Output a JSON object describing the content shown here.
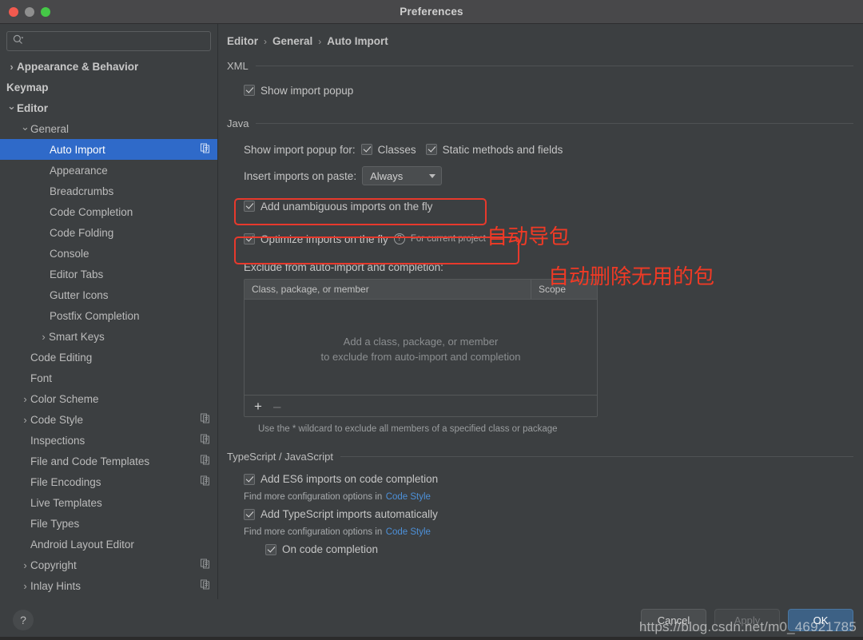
{
  "window": {
    "title": "Preferences",
    "traffic_lights": [
      "close",
      "minimize",
      "zoom"
    ]
  },
  "sidebar": {
    "search": {
      "value": "",
      "placeholder": ""
    },
    "items": [
      {
        "label": "Appearance & Behavior",
        "level": 0,
        "arrow": "collapsed",
        "bold": true,
        "selected": false,
        "copy_icon": false
      },
      {
        "label": "Keymap",
        "level": 0,
        "arrow": "none",
        "bold": true,
        "selected": false,
        "copy_icon": false
      },
      {
        "label": "Editor",
        "level": 0,
        "arrow": "expanded",
        "bold": true,
        "selected": false,
        "copy_icon": false
      },
      {
        "label": "General",
        "level": 1,
        "arrow": "expanded",
        "bold": false,
        "selected": false,
        "copy_icon": false
      },
      {
        "label": "Auto Import",
        "level": 2,
        "arrow": "none",
        "bold": false,
        "selected": true,
        "copy_icon": true
      },
      {
        "label": "Appearance",
        "level": 2,
        "arrow": "none",
        "bold": false,
        "selected": false,
        "copy_icon": false
      },
      {
        "label": "Breadcrumbs",
        "level": 2,
        "arrow": "none",
        "bold": false,
        "selected": false,
        "copy_icon": false
      },
      {
        "label": "Code Completion",
        "level": 2,
        "arrow": "none",
        "bold": false,
        "selected": false,
        "copy_icon": false
      },
      {
        "label": "Code Folding",
        "level": 2,
        "arrow": "none",
        "bold": false,
        "selected": false,
        "copy_icon": false
      },
      {
        "label": "Console",
        "level": 2,
        "arrow": "none",
        "bold": false,
        "selected": false,
        "copy_icon": false
      },
      {
        "label": "Editor Tabs",
        "level": 2,
        "arrow": "none",
        "bold": false,
        "selected": false,
        "copy_icon": false
      },
      {
        "label": "Gutter Icons",
        "level": 2,
        "arrow": "none",
        "bold": false,
        "selected": false,
        "copy_icon": false
      },
      {
        "label": "Postfix Completion",
        "level": 2,
        "arrow": "none",
        "bold": false,
        "selected": false,
        "copy_icon": false
      },
      {
        "label": "Smart Keys",
        "level": 2,
        "arrow": "collapsed",
        "bold": false,
        "selected": false,
        "copy_icon": false
      },
      {
        "label": "Code Editing",
        "level": 1,
        "arrow": "none",
        "bold": false,
        "selected": false,
        "copy_icon": false
      },
      {
        "label": "Font",
        "level": 1,
        "arrow": "none",
        "bold": false,
        "selected": false,
        "copy_icon": false
      },
      {
        "label": "Color Scheme",
        "level": 1,
        "arrow": "collapsed",
        "bold": false,
        "selected": false,
        "copy_icon": false
      },
      {
        "label": "Code Style",
        "level": 1,
        "arrow": "collapsed",
        "bold": false,
        "selected": false,
        "copy_icon": true
      },
      {
        "label": "Inspections",
        "level": 1,
        "arrow": "none",
        "bold": false,
        "selected": false,
        "copy_icon": true
      },
      {
        "label": "File and Code Templates",
        "level": 1,
        "arrow": "none",
        "bold": false,
        "selected": false,
        "copy_icon": true
      },
      {
        "label": "File Encodings",
        "level": 1,
        "arrow": "none",
        "bold": false,
        "selected": false,
        "copy_icon": true
      },
      {
        "label": "Live Templates",
        "level": 1,
        "arrow": "none",
        "bold": false,
        "selected": false,
        "copy_icon": false
      },
      {
        "label": "File Types",
        "level": 1,
        "arrow": "none",
        "bold": false,
        "selected": false,
        "copy_icon": false
      },
      {
        "label": "Android Layout Editor",
        "level": 1,
        "arrow": "none",
        "bold": false,
        "selected": false,
        "copy_icon": false
      },
      {
        "label": "Copyright",
        "level": 1,
        "arrow": "collapsed",
        "bold": false,
        "selected": false,
        "copy_icon": true
      },
      {
        "label": "Inlay Hints",
        "level": 1,
        "arrow": "collapsed",
        "bold": false,
        "selected": false,
        "copy_icon": true
      }
    ]
  },
  "breadcrumb": {
    "parts": [
      "Editor",
      "General",
      "Auto Import"
    ],
    "separator": "›"
  },
  "xml": {
    "section_title": "XML",
    "show_import_popup": {
      "label": "Show import popup",
      "checked": true
    }
  },
  "java": {
    "section_title": "Java",
    "show_import_popup_for_label": "Show import popup for:",
    "classes": {
      "label": "Classes",
      "checked": true
    },
    "static_methods": {
      "label": "Static methods and fields",
      "checked": true
    },
    "insert_imports_label": "Insert imports on paste:",
    "insert_imports_value": "Always",
    "add_unambiguous": {
      "label": "Add unambiguous imports on the fly",
      "checked": true
    },
    "optimize_imports": {
      "label": "Optimize imports on the fly",
      "checked": true,
      "scope_note": "For current project",
      "help_glyph": "?"
    },
    "exclude_label": "Exclude from auto-import and completion:",
    "table": {
      "columns": [
        "Class, package, or member",
        "Scope"
      ],
      "rows": [],
      "empty_line1": "Add a class, package, or member",
      "empty_line2": "to exclude from auto-import and completion",
      "add_glyph": "+",
      "remove_glyph": "–"
    },
    "wildcard_hint": "Use the * wildcard to exclude all members of a specified class or package"
  },
  "typescript": {
    "section_title": "TypeScript / JavaScript",
    "es6": {
      "label": "Add ES6 imports on code completion",
      "checked": true
    },
    "es6_hint_prefix": "Find more configuration options in",
    "es6_hint_link": "Code Style",
    "ts_auto": {
      "label": "Add TypeScript imports automatically",
      "checked": true
    },
    "ts_hint_prefix": "Find more configuration options in",
    "ts_hint_link": "Code Style",
    "on_code_completion": {
      "label": "On code completion",
      "checked": true
    }
  },
  "annotations": [
    {
      "text": "自动导包"
    },
    {
      "text": "自动删除无用的包"
    }
  ],
  "footer": {
    "help_glyph": "?",
    "cancel": "Cancel",
    "apply": "Apply",
    "ok": "OK"
  },
  "watermark": "https://blog.csdn.net/m0_46921785",
  "colors": {
    "window_bg": "#3c3f41",
    "titlebar_bg": "#48484a",
    "selection_blue": "#2f6ac9",
    "annotation_red": "#e8392c",
    "link_blue": "#4d90d8",
    "primary_button": "#3d6185"
  }
}
